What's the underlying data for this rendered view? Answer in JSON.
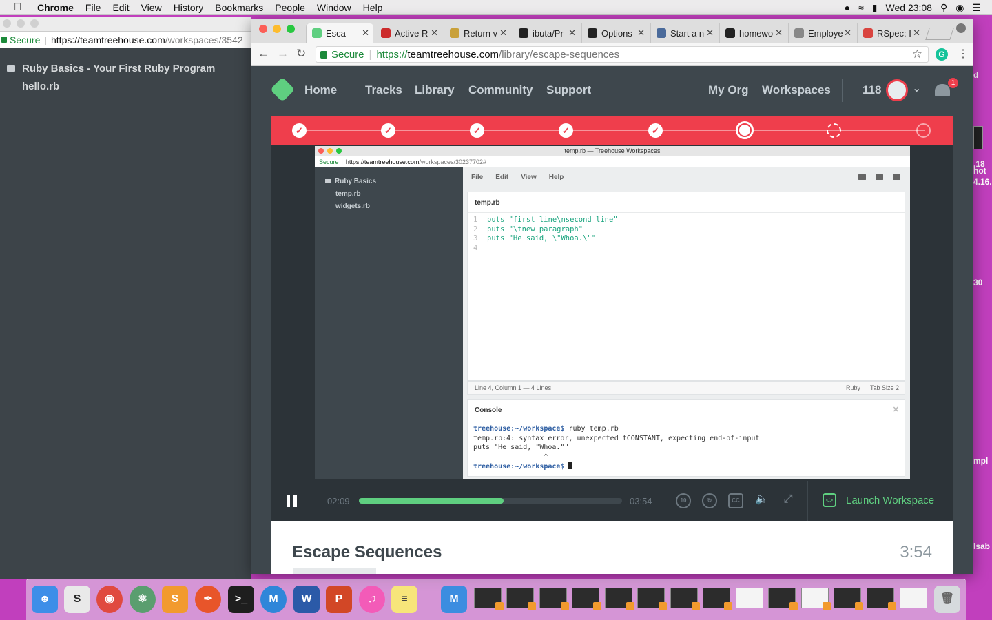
{
  "menubar": {
    "app": "Chrome",
    "items": [
      "File",
      "Edit",
      "View",
      "History",
      "Bookmarks",
      "People",
      "Window",
      "Help"
    ],
    "clock": "Wed 23:08"
  },
  "bg_window": {
    "secure": "Secure",
    "url_host": "https://teamtreehouse.com",
    "url_path": "/workspaces/3542",
    "folder": "Ruby Basics - Your First Ruby Program",
    "file": "hello.rb"
  },
  "desktop_fragments": [
    "d",
    ".18",
    "hot",
    "4.16.",
    "30",
    "mpl",
    "lsab"
  ],
  "browser": {
    "tabs": [
      {
        "label": "Esca",
        "color": "#5fcf80",
        "active": true
      },
      {
        "label": "Active R",
        "color": "#cc2b2b"
      },
      {
        "label": "Return v",
        "color": "#c9a13a"
      },
      {
        "label": "ibuta/Pr",
        "color": "#222222"
      },
      {
        "label": "Options",
        "color": "#222222"
      },
      {
        "label": "Start a n",
        "color": "#4a6a9a"
      },
      {
        "label": "homewo",
        "color": "#222222"
      },
      {
        "label": "Employe",
        "color": "#888888"
      },
      {
        "label": "RSpec: I",
        "color": "#d9443f"
      }
    ],
    "secure": "Secure",
    "url_scheme": "https://",
    "url_host": "teamtreehouse.com",
    "url_path": "/library/escape-sequences"
  },
  "site": {
    "nav": [
      "Home",
      "Tracks",
      "Library",
      "Community",
      "Support"
    ],
    "right_nav": [
      "My Org",
      "Workspaces"
    ],
    "points": "118",
    "notifications": "1"
  },
  "video": {
    "window_title": "temp.rb — Treehouse Workspaces",
    "secure": "Secure",
    "url_host": "https://teamtreehouse.com",
    "url_path": "/workspaces/30237702#",
    "tree_folder": "Ruby Basics",
    "tree_files": [
      "temp.rb",
      "widgets.rb"
    ],
    "menu": [
      "File",
      "Edit",
      "View",
      "Help"
    ],
    "editor_tab": "temp.rb",
    "code": [
      {
        "n": "1",
        "text": "puts \"first line\\nsecond line\""
      },
      {
        "n": "2",
        "text": "puts \"\\tnew paragraph\""
      },
      {
        "n": "3",
        "text": "puts \"He said, \\\"Whoa.\\\"\""
      },
      {
        "n": "4",
        "text": ""
      }
    ],
    "status_left": "Line 4, Column 1 — 4 Lines",
    "status_lang": "Ruby",
    "status_tab": "Tab Size 2",
    "console_title": "Console",
    "console_prompt": "treehouse:~/workspace$",
    "console_cmd": " ruby temp.rb",
    "console_err1": "temp.rb:4: syntax error, unexpected tCONSTANT, expecting end-of-input",
    "console_err2": "puts \"He said, \"Whoa.\"\"",
    "console_caret": "                 ^",
    "elapsed": "02:09",
    "total": "03:54",
    "progress": 0.55,
    "launch": "Launch Workspace"
  },
  "lesson": {
    "title": "Escape Sequences",
    "duration": "3:54"
  },
  "colors": {
    "brand_green": "#5fcf80",
    "accent_red": "#ef3e4c",
    "page_bg": "#3e474d",
    "desktop": "#c13fbd"
  }
}
